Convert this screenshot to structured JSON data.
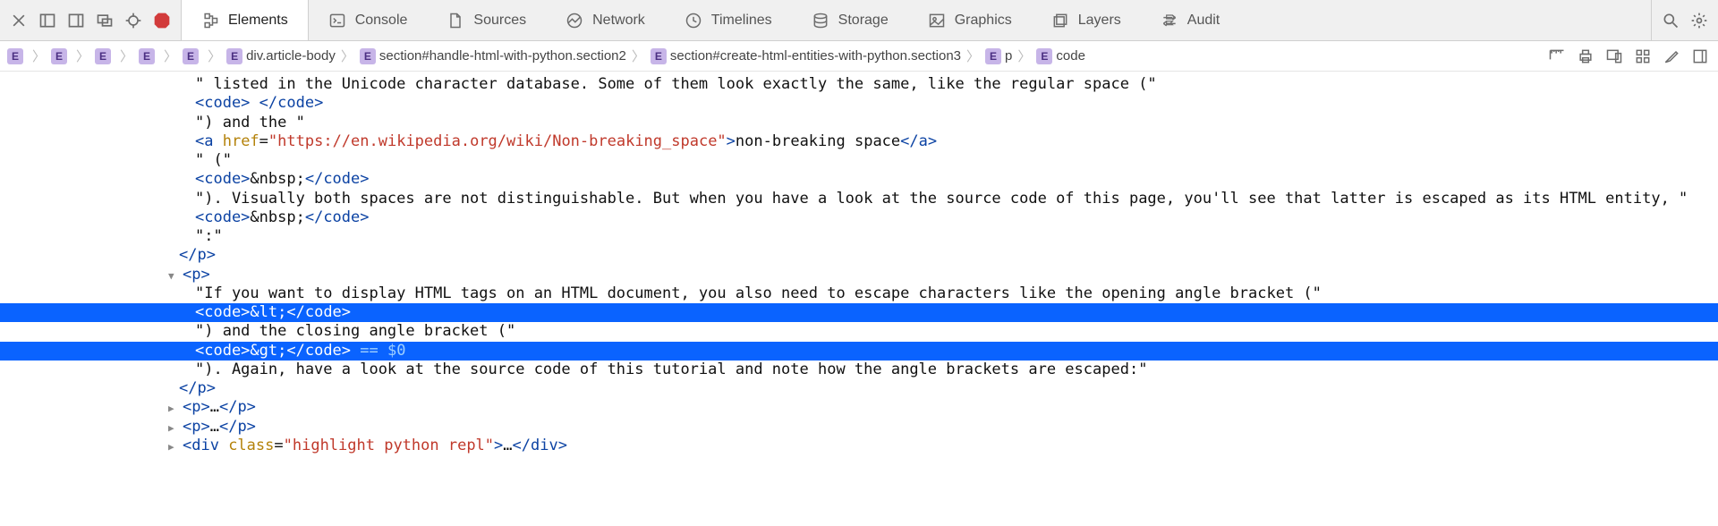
{
  "toolbar": {
    "close_icon": "close",
    "panel1_icon": "left-panel",
    "panel2_icon": "right-panel",
    "dock_icon": "dock",
    "inspect_icon": "target",
    "stop_icon": "stop"
  },
  "tabs": [
    {
      "label": "Elements",
      "active": true
    },
    {
      "label": "Console",
      "active": false
    },
    {
      "label": "Sources",
      "active": false
    },
    {
      "label": "Network",
      "active": false
    },
    {
      "label": "Timelines",
      "active": false
    },
    {
      "label": "Storage",
      "active": false
    },
    {
      "label": "Graphics",
      "active": false
    },
    {
      "label": "Layers",
      "active": false
    },
    {
      "label": "Audit",
      "active": false
    }
  ],
  "breadcrumbs": [
    {
      "label": ""
    },
    {
      "label": ""
    },
    {
      "label": ""
    },
    {
      "label": ""
    },
    {
      "label": ""
    },
    {
      "label": "div.article-body"
    },
    {
      "label": "section#handle-html-with-python.section2"
    },
    {
      "label": "section#create-html-entities-with-python.section3"
    },
    {
      "label": "p"
    },
    {
      "label": "code"
    }
  ],
  "dom": {
    "line1_text": "\" listed in the Unicode character database. Some of them look exactly the same, like the regular space (\"",
    "line2_open": "<code>",
    "line2_text": " ",
    "line2_close": "</code>",
    "line3_text": "\") and the \"",
    "line4_open": "<a ",
    "line4_attr": "href",
    "line4_val": "\"https://en.wikipedia.org/wiki/Non-breaking_space\"",
    "line4_textinner": "non-breaking space",
    "line4_close": "</a>",
    "line5_text": "\" (\"",
    "line6_open": "<code>",
    "line6_text": "&nbsp;",
    "line6_close": "</code>",
    "line7_text": "\"). Visually both spaces are not distinguishable. But when you have a look at the source code of this page, you'll see that latter is escaped as its HTML entity, \"",
    "line8_open": "<code>",
    "line8_text": "&nbsp;",
    "line8_close": "</code>",
    "line9_text": "\":\"",
    "line10_close": "</p>",
    "line11_open": "<p>",
    "line12_text": "\"If you want to display HTML tags on an HTML document, you also need to escape characters like the opening angle bracket (\"",
    "sel1_open": "<code>",
    "sel1_text": "&lt;",
    "sel1_close": "</code>",
    "line14_text": "\") and the closing angle bracket (\"",
    "sel2_open": "<code>",
    "sel2_text": "&gt;",
    "sel2_close": "</code>",
    "sel2_cons": " == $0",
    "line16_text": "\"). Again, have a look at the source code of this tutorial and note how the angle brackets are escaped:\"",
    "line17_close": "</p>",
    "line18_open": "<p>",
    "line18_ell": "…",
    "line18_close": "</p>",
    "line19_open": "<p>",
    "line19_ell": "…",
    "line19_close": "</p>",
    "line20_open": "<div ",
    "line20_attr": "class",
    "line20_val": "\"highlight python repl\"",
    "line20_close": ">",
    "line20_ell": "…",
    "line20_closetag": "</div>"
  }
}
